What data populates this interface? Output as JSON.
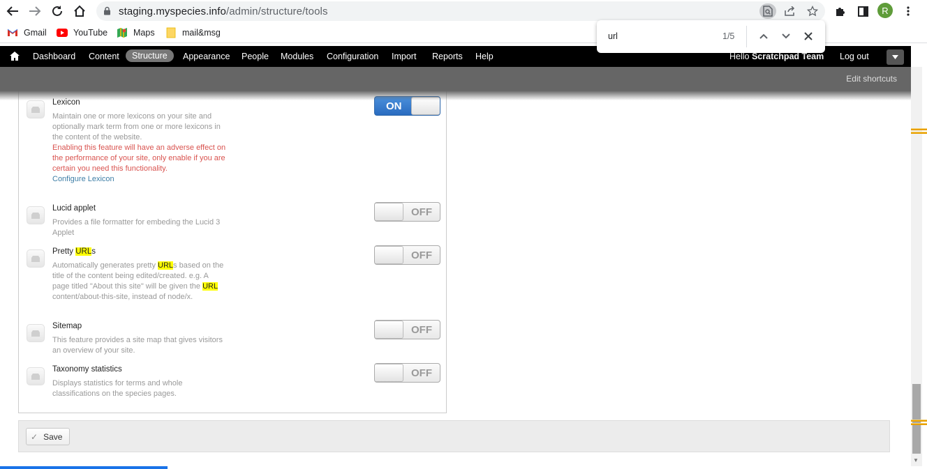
{
  "browser": {
    "url_host": "staging.myspecies.info",
    "url_path": "/admin/structure/tools",
    "bookmarks": [
      {
        "label": "Gmail",
        "icon": "gmail-icon"
      },
      {
        "label": "YouTube",
        "icon": "youtube-icon"
      },
      {
        "label": "Maps",
        "icon": "maps-icon"
      },
      {
        "label": "mail&msg",
        "icon": "folder-icon"
      }
    ],
    "avatar_letter": "R",
    "find": {
      "query": "url",
      "count": "1/5"
    }
  },
  "admin_bar": {
    "items": [
      "Dashboard",
      "Content",
      "Structure",
      "Appearance",
      "People",
      "Modules",
      "Configuration",
      "Import",
      "Reports",
      "Help"
    ],
    "active": "Structure",
    "hello_prefix": "Hello ",
    "hello_user": "Scratchpad Team",
    "logout": "Log out",
    "edit_shortcuts": "Edit shortcuts"
  },
  "tools": [
    {
      "title": "Lexicon",
      "desc": "Maintain one or more lexicons on your site and optionally mark term from one or more lexicons in the content of the website.",
      "warning": "Enabling this feature will have an adverse effect on the performance of your site, only enable if you are certain you need this functionality.",
      "link": "Configure Lexicon",
      "state": "ON"
    },
    {
      "title": "Lucid applet",
      "desc": "Provides a file formatter for embeding the Lucid 3 Applet",
      "state": "OFF"
    },
    {
      "title_parts": [
        "Pretty ",
        "URL",
        "s"
      ],
      "desc_parts": [
        "Automatically generates pretty ",
        "URL",
        "s based on the title of the content being edited/created. e.g. A page titled \"About this site\" will be given the ",
        "URL",
        " content/about-this-site, instead of node/x."
      ],
      "state": "OFF"
    },
    {
      "title": "Sitemap",
      "desc": "This feature provides a site map that gives visitors an overview of your site.",
      "state": "OFF"
    },
    {
      "title": "Taxonomy statistics",
      "desc": "Displays statistics for terms and whole classifications on the species pages.",
      "state": "OFF"
    }
  ],
  "actions": {
    "save_label": "Save"
  }
}
